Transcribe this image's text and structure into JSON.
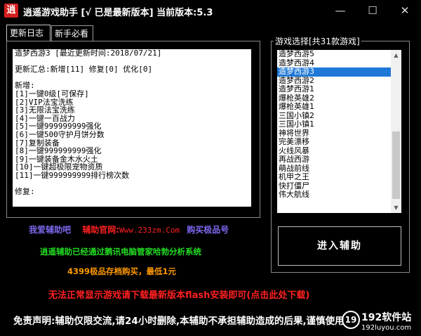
{
  "window": {
    "icon_char": "逍",
    "title": "逍遥游戏助手 [√ 已是最新版本]  当前版本:5.3",
    "minimize": "—",
    "maximize": "☐",
    "close": "✕"
  },
  "tabs": [
    {
      "label": "更新日志",
      "active": true
    },
    {
      "label": "新手必看",
      "active": false
    }
  ],
  "log_lines": [
    "造梦西游3 [最近更新时间:2018/07/21]",
    "",
    "更新汇总:新增[11] 修复[0] 优化[0]",
    "",
    "新增:",
    "[1]一键0级[可保存]",
    "[2]VIP法宝洗练",
    "[3]无限法宝洗练",
    "[4]一键一百战力",
    "[5]一键999999999强化",
    "[6]一键500守护月饼分数",
    "[7]复制装备",
    "[8]一键999999999强化",
    "[9]一键装备金木水火土",
    "[10]一键超极限宠物资质",
    "[11]一键999999999排行榜次数",
    "",
    "修复:"
  ],
  "game_group": {
    "title": "游戏选择[共31款游戏]",
    "items": [
      "造梦西游5",
      "造梦西游4",
      "造梦西游3",
      "造梦西游2",
      "造梦西游1",
      "爆枪英雄2",
      "爆枪英雄1",
      "三国小镇2",
      "三国小镇1",
      "神将世界",
      "完美漂移",
      "火线风暴",
      "再战西游",
      "萌战前线",
      "机甲之王",
      "快打僵尸",
      "伟大航线"
    ],
    "selected_index": 2,
    "scroll_up": "▲",
    "scroll_down": "▼"
  },
  "enter_button": "进入辅助",
  "links": {
    "love": "我爱辅助吧",
    "site_label": "辅助官网:",
    "site_url": "Www.233zm.Com",
    "buy": "购买极品号"
  },
  "security_text": "逍遥辅助已经通过鹅讯电脑管家哈勃分析系统",
  "promo_text": "4399极品存档购买，最低1元",
  "flash_note": "无法正常显示游戏请下载最新版本flash安装即可(点击此处下载)",
  "disclaimer": "免责声明:辅助仅限交流,请24小时删除,本辅助不承担辅助造成的后果,谨慎使用",
  "watermark": {
    "icon": "19",
    "name": "192软件站",
    "url": "192luyou.com"
  },
  "colors": {
    "selection": "#1e78d7",
    "red": "#ff2020",
    "purple": "#7b68ee",
    "green": "#22dd22",
    "orange": "#ff9900"
  }
}
